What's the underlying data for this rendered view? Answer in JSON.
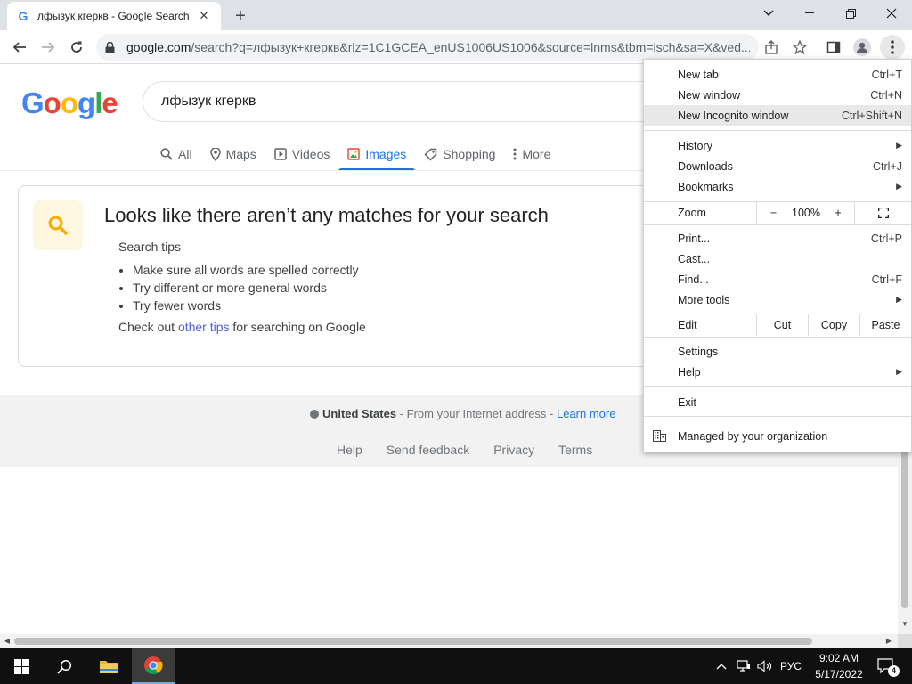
{
  "tab": {
    "title": "лфызук кгеркв - Google Search",
    "favicon": "G"
  },
  "omnibox": {
    "host": "google.com",
    "path": "/search?q=лфызук+кгеркв&rlz=1C1GCEA_enUS1006US1006&source=lnms&tbm=isch&sa=X&ved..."
  },
  "google": {
    "logo": [
      "G",
      "o",
      "o",
      "g",
      "l",
      "e"
    ],
    "logo_colors": [
      "#4285f4",
      "#ea4335",
      "#fbbc05",
      "#4285f4",
      "#34a853",
      "#ea4335"
    ],
    "query": "лфызук кгеркв",
    "tabs": [
      {
        "label": "All",
        "icon": "search-icon"
      },
      {
        "label": "Maps",
        "icon": "map-pin-icon"
      },
      {
        "label": "Videos",
        "icon": "play-icon"
      },
      {
        "label": "Images",
        "icon": "image-icon"
      },
      {
        "label": "Shopping",
        "icon": "tag-icon"
      },
      {
        "label": "More",
        "icon": "more-vertical-icon"
      }
    ],
    "active_tab": "Images"
  },
  "results": {
    "heading": "Looks like there aren’t any matches for your search",
    "tips_heading": "Search tips",
    "tips": [
      "Make sure all words are spelled correctly",
      "Try different or more general words",
      "Try fewer words"
    ],
    "checkout_prefix": "Check out ",
    "checkout_link": "other tips",
    "checkout_suffix": " for searching on Google"
  },
  "footer": {
    "country": "United States",
    "location_text": " - From your Internet address - ",
    "learn_more": "Learn more",
    "links": [
      "Help",
      "Send feedback",
      "Privacy",
      "Terms"
    ]
  },
  "menu": {
    "new_tab": {
      "label": "New tab",
      "shortcut": "Ctrl+T"
    },
    "new_window": {
      "label": "New window",
      "shortcut": "Ctrl+N"
    },
    "new_incognito": {
      "label": "New Incognito window",
      "shortcut": "Ctrl+Shift+N"
    },
    "history": {
      "label": "History"
    },
    "downloads": {
      "label": "Downloads",
      "shortcut": "Ctrl+J"
    },
    "bookmarks": {
      "label": "Bookmarks"
    },
    "zoom": {
      "label": "Zoom",
      "minus": "−",
      "level": "100%",
      "plus": "+"
    },
    "print": {
      "label": "Print...",
      "shortcut": "Ctrl+P"
    },
    "cast": {
      "label": "Cast..."
    },
    "find": {
      "label": "Find...",
      "shortcut": "Ctrl+F"
    },
    "more_tools": {
      "label": "More tools"
    },
    "edit": {
      "label": "Edit",
      "cut": "Cut",
      "copy": "Copy",
      "paste": "Paste"
    },
    "settings": {
      "label": "Settings"
    },
    "help": {
      "label": "Help"
    },
    "exit": {
      "label": "Exit"
    },
    "managed": {
      "label": "Managed by your organization"
    }
  },
  "taskbar": {
    "language": "РУС",
    "time": "9:02 AM",
    "date": "5/17/2022",
    "notifications": "4"
  }
}
